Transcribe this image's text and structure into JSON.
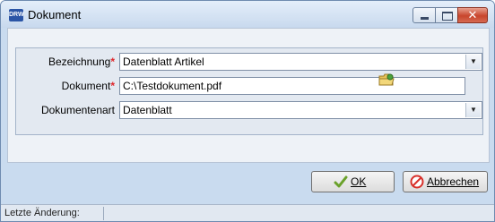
{
  "window": {
    "title": "Dokument",
    "app_icon_text": "DRW"
  },
  "form": {
    "bezeichnung_label": "Bezeichnung",
    "bezeichnung_value": "Datenblatt Artikel",
    "dokument_label": "Dokument",
    "dokument_value": "C:\\Testdokument.pdf",
    "dokumentenart_label": "Dokumentenart",
    "dokumentenart_value": "Datenblatt",
    "required_marker": "*"
  },
  "buttons": {
    "ok_label": "OK",
    "cancel_label": "Abbrechen"
  },
  "status": {
    "last_change_label": "Letzte Änderung:"
  },
  "colors": {
    "required": "#e0262b",
    "ok_check": "#6aa12a",
    "cancel_icon": "#d8302a"
  }
}
